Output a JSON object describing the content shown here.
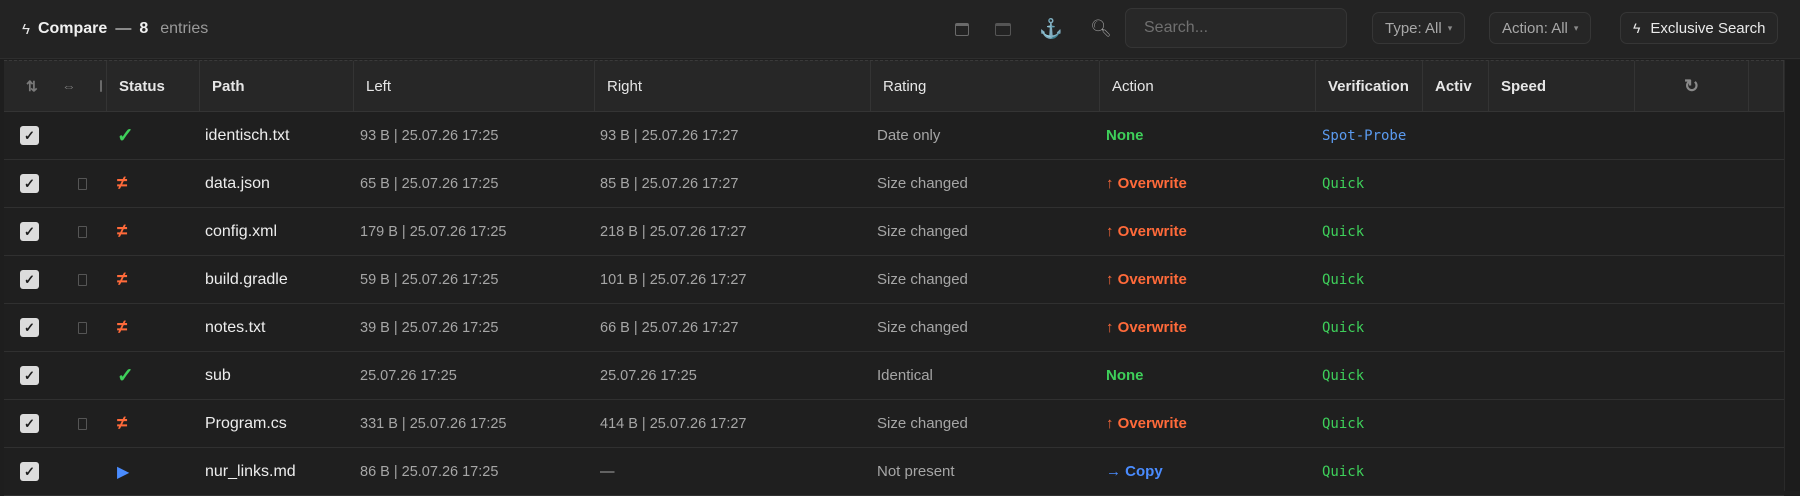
{
  "toolbar": {
    "bolt_icon": "bolt-icon",
    "title": "Compare",
    "dash": "—",
    "count": "8",
    "entries_label": "entries",
    "search_placeholder": "Search...",
    "type_filter": "Type: All",
    "action_filter": "Action: All",
    "exclusive_search": "Exclusive Search",
    "anchor_color": "#e8a030"
  },
  "columns": {
    "sort_icon": "⇅",
    "swap_icon": "⇔",
    "status": "Status",
    "path": "Path",
    "left": "Left",
    "right": "Right",
    "rating": "Rating",
    "action": "Action",
    "verification": "Verification",
    "activ": "Activ",
    "speed": "Speed"
  },
  "colors": {
    "ok": "#3ecf5a",
    "diff": "#ff6a3a",
    "copy": "#4a8cff",
    "quick": "#3ecf5a",
    "spot": "#5b9bf0"
  },
  "rows": [
    {
      "checked": true,
      "doc": false,
      "status": "✓",
      "status_type": "ok",
      "path": "identisch.txt",
      "left": "93 B | 25.07.26 17:25",
      "right": "93 B | 25.07.26 17:27",
      "rating": "Date only",
      "action": "None",
      "action_type": "none",
      "verification": "Spot-Probe",
      "verif_type": "spot"
    },
    {
      "checked": true,
      "doc": true,
      "status": "≠",
      "status_type": "diff",
      "path": "data.json",
      "left": "65 B | 25.07.26 17:25",
      "right": "85 B | 25.07.26 17:27",
      "rating": "Size changed",
      "action": "↑ Overwrite",
      "action_type": "overwrite",
      "verification": "Quick",
      "verif_type": "quick"
    },
    {
      "checked": true,
      "doc": true,
      "status": "≠",
      "status_type": "diff",
      "path": "config.xml",
      "left": "179 B | 25.07.26 17:25",
      "right": "218 B | 25.07.26 17:27",
      "rating": "Size changed",
      "action": "↑ Overwrite",
      "action_type": "overwrite",
      "verification": "Quick",
      "verif_type": "quick"
    },
    {
      "checked": true,
      "doc": true,
      "status": "≠",
      "status_type": "diff",
      "path": "build.gradle",
      "left": "59 B | 25.07.26 17:25",
      "right": "101 B | 25.07.26 17:27",
      "rating": "Size changed",
      "action": "↑ Overwrite",
      "action_type": "overwrite",
      "verification": "Quick",
      "verif_type": "quick"
    },
    {
      "checked": true,
      "doc": true,
      "status": "≠",
      "status_type": "diff",
      "path": "notes.txt",
      "left": "39 B | 25.07.26 17:25",
      "right": "66 B | 25.07.26 17:27",
      "rating": "Size changed",
      "action": "↑ Overwrite",
      "action_type": "overwrite",
      "verification": "Quick",
      "verif_type": "quick"
    },
    {
      "checked": true,
      "doc": false,
      "status": "✓",
      "status_type": "ok",
      "path": "sub",
      "left": "25.07.26 17:25",
      "right": "25.07.26 17:25",
      "rating": "Identical",
      "action": "None",
      "action_type": "none",
      "verification": "Quick",
      "verif_type": "quick"
    },
    {
      "checked": true,
      "doc": true,
      "status": "≠",
      "status_type": "diff",
      "path": "Program.cs",
      "left": "331 B | 25.07.26 17:25",
      "right": "414 B | 25.07.26 17:27",
      "rating": "Size changed",
      "action": "↑ Overwrite",
      "action_type": "overwrite",
      "verification": "Quick",
      "verif_type": "quick"
    },
    {
      "checked": true,
      "doc": false,
      "status": "▶",
      "status_type": "left",
      "path": "nur_links.md",
      "left": "86 B | 25.07.26 17:25",
      "right": "—",
      "rating": "Not present",
      "action": "→ Copy",
      "action_type": "copy",
      "verification": "Quick",
      "verif_type": "quick"
    }
  ]
}
